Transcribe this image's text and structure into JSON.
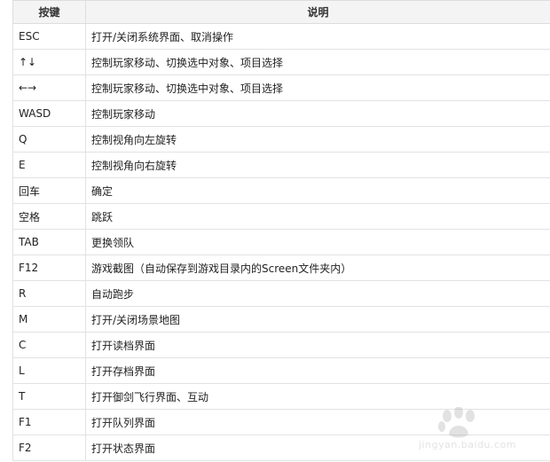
{
  "header": {
    "key": "按键",
    "desc": "说明"
  },
  "rows": [
    {
      "key": "ESC",
      "desc": "打开/关闭系统界面、取消操作"
    },
    {
      "key": "↑↓",
      "desc": "控制玩家移动、切换选中对象、项目选择"
    },
    {
      "key": "←→",
      "desc": "控制玩家移动、切换选中对象、项目选择"
    },
    {
      "key": "WASD",
      "desc": "控制玩家移动"
    },
    {
      "key": "Q",
      "desc": "控制视角向左旋转"
    },
    {
      "key": "E",
      "desc": "控制视角向右旋转"
    },
    {
      "key": "回车",
      "desc": "确定"
    },
    {
      "key": "空格",
      "desc": "跳跃"
    },
    {
      "key": "TAB",
      "desc": "更换领队"
    },
    {
      "key": "F12",
      "desc": "游戏截图（自动保存到游戏目录内的Screen文件夹内）"
    },
    {
      "key": "R",
      "desc": "自动跑步"
    },
    {
      "key": "M",
      "desc": "打开/关闭场景地图"
    },
    {
      "key": "C",
      "desc": "打开读档界面"
    },
    {
      "key": "L",
      "desc": "打开存档界面"
    },
    {
      "key": "T",
      "desc": "打开御剑飞行界面、互动"
    },
    {
      "key": "F1",
      "desc": "打开队列界面"
    },
    {
      "key": "F2",
      "desc": "打开状态界面"
    }
  ],
  "watermark": {
    "sub": "jingyan.baidu.com"
  },
  "colors": {
    "header_bg": "#f4f4f4",
    "border": "#e2e2e2",
    "text": "#222222"
  }
}
